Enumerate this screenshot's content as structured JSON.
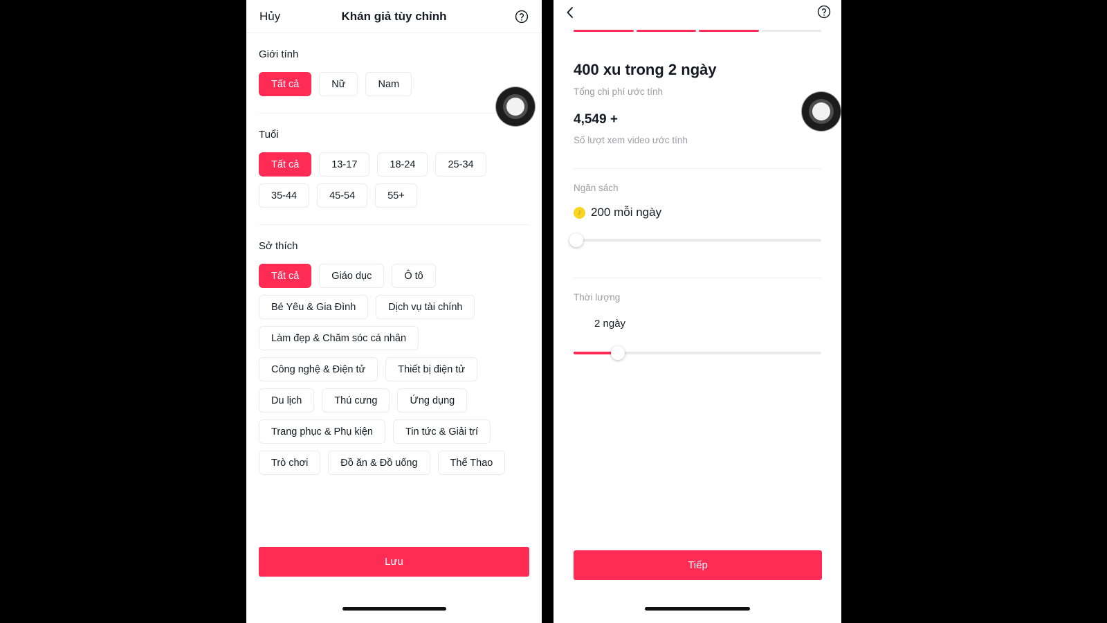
{
  "accent_color": "#fe2c55",
  "left_panel": {
    "nav": {
      "cancel_label": "Hủy",
      "title": "Khán giả tùy chỉnh",
      "help_icon": "help-circle-icon"
    },
    "sections": [
      {
        "id": "gender",
        "title": "Giới tính",
        "options": [
          {
            "label": "Tất cả",
            "selected": true
          },
          {
            "label": "Nữ",
            "selected": false
          },
          {
            "label": "Nam",
            "selected": false
          }
        ]
      },
      {
        "id": "age",
        "title": "Tuổi",
        "options": [
          {
            "label": "Tất cả",
            "selected": true
          },
          {
            "label": "13-17",
            "selected": false
          },
          {
            "label": "18-24",
            "selected": false
          },
          {
            "label": "25-34",
            "selected": false
          },
          {
            "label": "35-44",
            "selected": false
          },
          {
            "label": "45-54",
            "selected": false
          },
          {
            "label": "55+",
            "selected": false
          }
        ]
      },
      {
        "id": "interests",
        "title": "Sở thích",
        "options": [
          {
            "label": "Tất cả",
            "selected": true
          },
          {
            "label": "Giáo dục",
            "selected": false
          },
          {
            "label": "Ô tô",
            "selected": false
          },
          {
            "label": "Bé Yêu & Gia Đình",
            "selected": false
          },
          {
            "label": "Dịch vụ tài chính",
            "selected": false
          },
          {
            "label": "Làm đẹp & Chăm sóc cá nhân",
            "selected": false
          },
          {
            "label": "Công nghệ & Điện tử",
            "selected": false
          },
          {
            "label": "Thiết bị điện tử",
            "selected": false
          },
          {
            "label": "Du lịch",
            "selected": false
          },
          {
            "label": "Thú cưng",
            "selected": false
          },
          {
            "label": "Ứng dụng",
            "selected": false
          },
          {
            "label": "Trang phục & Phụ kiện",
            "selected": false
          },
          {
            "label": "Tin tức & Giải trí",
            "selected": false
          },
          {
            "label": "Trò chơi",
            "selected": false
          },
          {
            "label": "Đồ ăn & Đồ uống",
            "selected": false
          },
          {
            "label": "Thể Thao",
            "selected": false
          }
        ]
      }
    ],
    "save_label": "Lưu"
  },
  "right_panel": {
    "nav": {
      "back_icon": "chevron-left-icon",
      "help_icon": "help-circle-icon"
    },
    "progress": {
      "total_steps": 4,
      "completed_steps": 3
    },
    "summary": {
      "headline": "400 xu trong 2 ngày",
      "headline_caption": "Tổng chi phí ước tính",
      "views": "4,549 +",
      "views_caption": "Số lượt xem video ước tính"
    },
    "budget": {
      "label": "Ngân sách",
      "coin_icon": "coin-icon",
      "value": "200 mỗi ngày",
      "slider_percent": 0
    },
    "duration": {
      "label": "Thời lượng",
      "value": "2 ngày",
      "slider_percent": 18
    },
    "next_label": "Tiếp"
  },
  "touch_indicators": [
    {
      "name": "touch-indicator-left"
    },
    {
      "name": "touch-indicator-right"
    }
  ]
}
